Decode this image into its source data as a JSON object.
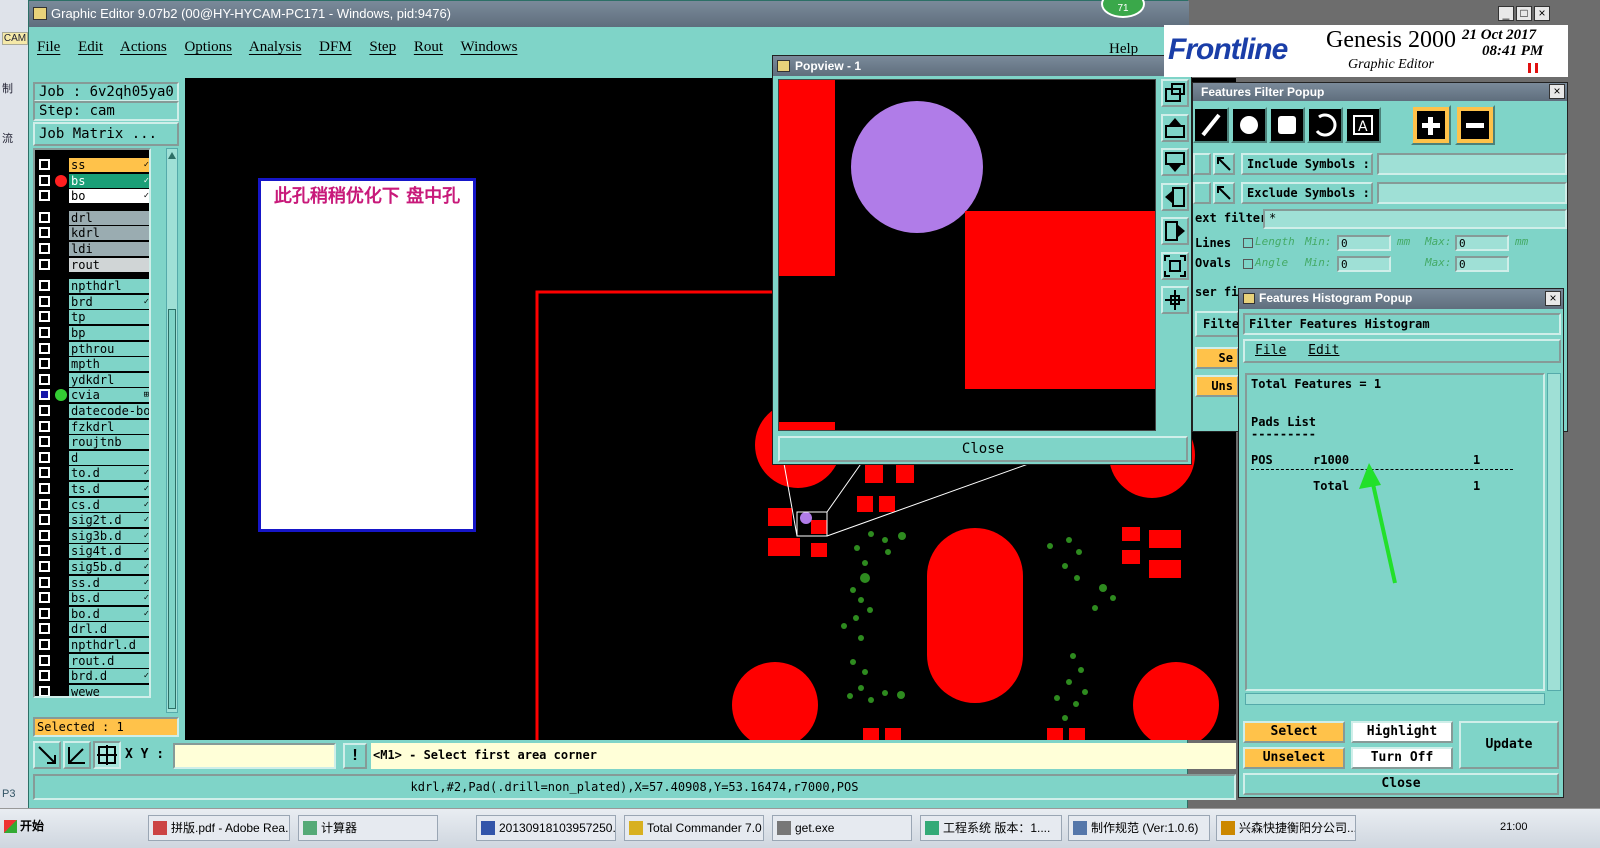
{
  "desktop": {
    "left_labels": [
      "CAM",
      "制",
      "流",
      "P3"
    ]
  },
  "main_window": {
    "title": "Graphic Editor 9.07b2 (00@HY-HYCAM-PC171 - Windows, pid:9476)",
    "badge": "71",
    "menu": [
      "File",
      "Edit",
      "Actions",
      "Options",
      "Analysis",
      "DFM",
      "Step",
      "Rout",
      "Windows"
    ],
    "help": "Help"
  },
  "left_panel": {
    "job": "Job : 6v2qh05ya0",
    "step": "Step: cam",
    "job_matrix": "Job Matrix ...",
    "layers": [
      {
        "name": "ss",
        "style": "yel",
        "mark": "✓"
      },
      {
        "name": "bs",
        "style": "grn",
        "mark": "✓",
        "active": true
      },
      {
        "name": "bo",
        "style": "wht",
        "mark": "✓"
      },
      {
        "name": "drl",
        "style": "gry"
      },
      {
        "name": "kdrl",
        "style": "gry"
      },
      {
        "name": "ldi",
        "style": "gry"
      },
      {
        "name": "rout",
        "style": "lgy"
      },
      {
        "name": "npthdrl",
        "style": ""
      },
      {
        "name": "brd",
        "style": "",
        "mark": "✓"
      },
      {
        "name": "tp",
        "style": ""
      },
      {
        "name": "bp",
        "style": ""
      },
      {
        "name": "pthrou",
        "style": ""
      },
      {
        "name": "mpth",
        "style": ""
      },
      {
        "name": "ydkdrl",
        "style": ""
      },
      {
        "name": "cvia",
        "style": "",
        "mark": "⊞",
        "work": true
      },
      {
        "name": "datecode-bo",
        "style": ""
      },
      {
        "name": "fzkdrl",
        "style": ""
      },
      {
        "name": "roujtnb",
        "style": ""
      },
      {
        "name": "d",
        "style": ""
      },
      {
        "name": "to.d",
        "style": "",
        "mark": "✓"
      },
      {
        "name": "ts.d",
        "style": "",
        "mark": "✓"
      },
      {
        "name": "cs.d",
        "style": "",
        "mark": "✓"
      },
      {
        "name": "sig2t.d",
        "style": "",
        "mark": "✓"
      },
      {
        "name": "sig3b.d",
        "style": "",
        "mark": "✓"
      },
      {
        "name": "sig4t.d",
        "style": "",
        "mark": "✓"
      },
      {
        "name": "sig5b.d",
        "style": "",
        "mark": "✓"
      },
      {
        "name": "ss.d",
        "style": "",
        "mark": "✓"
      },
      {
        "name": "bs.d",
        "style": "",
        "mark": "✓"
      },
      {
        "name": "bo.d",
        "style": "",
        "mark": "✓"
      },
      {
        "name": "drl.d",
        "style": ""
      },
      {
        "name": "npthdrl.d",
        "style": ""
      },
      {
        "name": "rout.d",
        "style": ""
      },
      {
        "name": "brd.d",
        "style": "",
        "mark": "✓"
      },
      {
        "name": "wewe",
        "style": ""
      }
    ],
    "selected": "Selected : 1"
  },
  "canvas": {
    "note": "此孔稍稍优化下  盘中孔"
  },
  "bottom": {
    "xy_label": "X Y :",
    "xy_value": "",
    "prompt": "<M1> - Select first area corner",
    "status": "kdrl,#2,Pad(.drill=non_plated),X=57.40908,Y=53.16474,r7000,POS"
  },
  "popview": {
    "title": "Popview - 1",
    "close": "Close"
  },
  "brand": {
    "logo": "Frontline",
    "product": "Genesis 2000",
    "subtitle": "Graphic Editor",
    "date": "21 Oct 2017",
    "time": "08:41 PM"
  },
  "features_filter": {
    "title": "Features Filter Popup",
    "include_label": "Include Symbols :",
    "include_value": "",
    "exclude_label": "Exclude Symbols :",
    "exclude_value": "",
    "text_filter_label": "ext filter",
    "text_filter_value": "*",
    "lines": "Lines",
    "ovals": "Ovals",
    "length": "Length",
    "angle": "Angle",
    "min": "Min:",
    "max": "Max:",
    "unit": "mm",
    "length_min": "0",
    "length_max": "0",
    "angle_min": "0",
    "angle_max": "0",
    "user_filter": "ser fi",
    "filter": "Filte",
    "se": "Se",
    "uns": "Uns"
  },
  "histogram": {
    "title": "Features Histogram Popup",
    "header": "Filter Features Histogram",
    "menu": [
      "File",
      "Edit"
    ],
    "total_features": "Total Features = 1",
    "pads_list": "Pads List",
    "underline": "---------",
    "row_type": "POS",
    "row_symbol": "r1000",
    "row_count": "1",
    "total_label": "Total",
    "total_count": "1",
    "buttons": {
      "select": "Select",
      "highlight": "Highlight",
      "unselect": "Unselect",
      "turn_off": "Turn Off",
      "update": "Update",
      "close": "Close"
    }
  },
  "taskbar": {
    "start": "开始",
    "tasks": [
      "拼版.pdf - Adobe Rea...",
      "计算器",
      "20130918103957250....",
      "Total Commander 7.0 ...",
      "get.exe",
      "工程系统  版本：1....",
      "制作规范 (Ver:1.0.6)",
      "兴森快捷衡阳分公司..."
    ],
    "clock": "21:00"
  },
  "colors": {
    "panel": "#7fd4c8",
    "copper": "#ff0000",
    "selected_pad": "#b07ce8",
    "drill_dots": "#2e8b1f",
    "arrow": "#22e02a"
  }
}
